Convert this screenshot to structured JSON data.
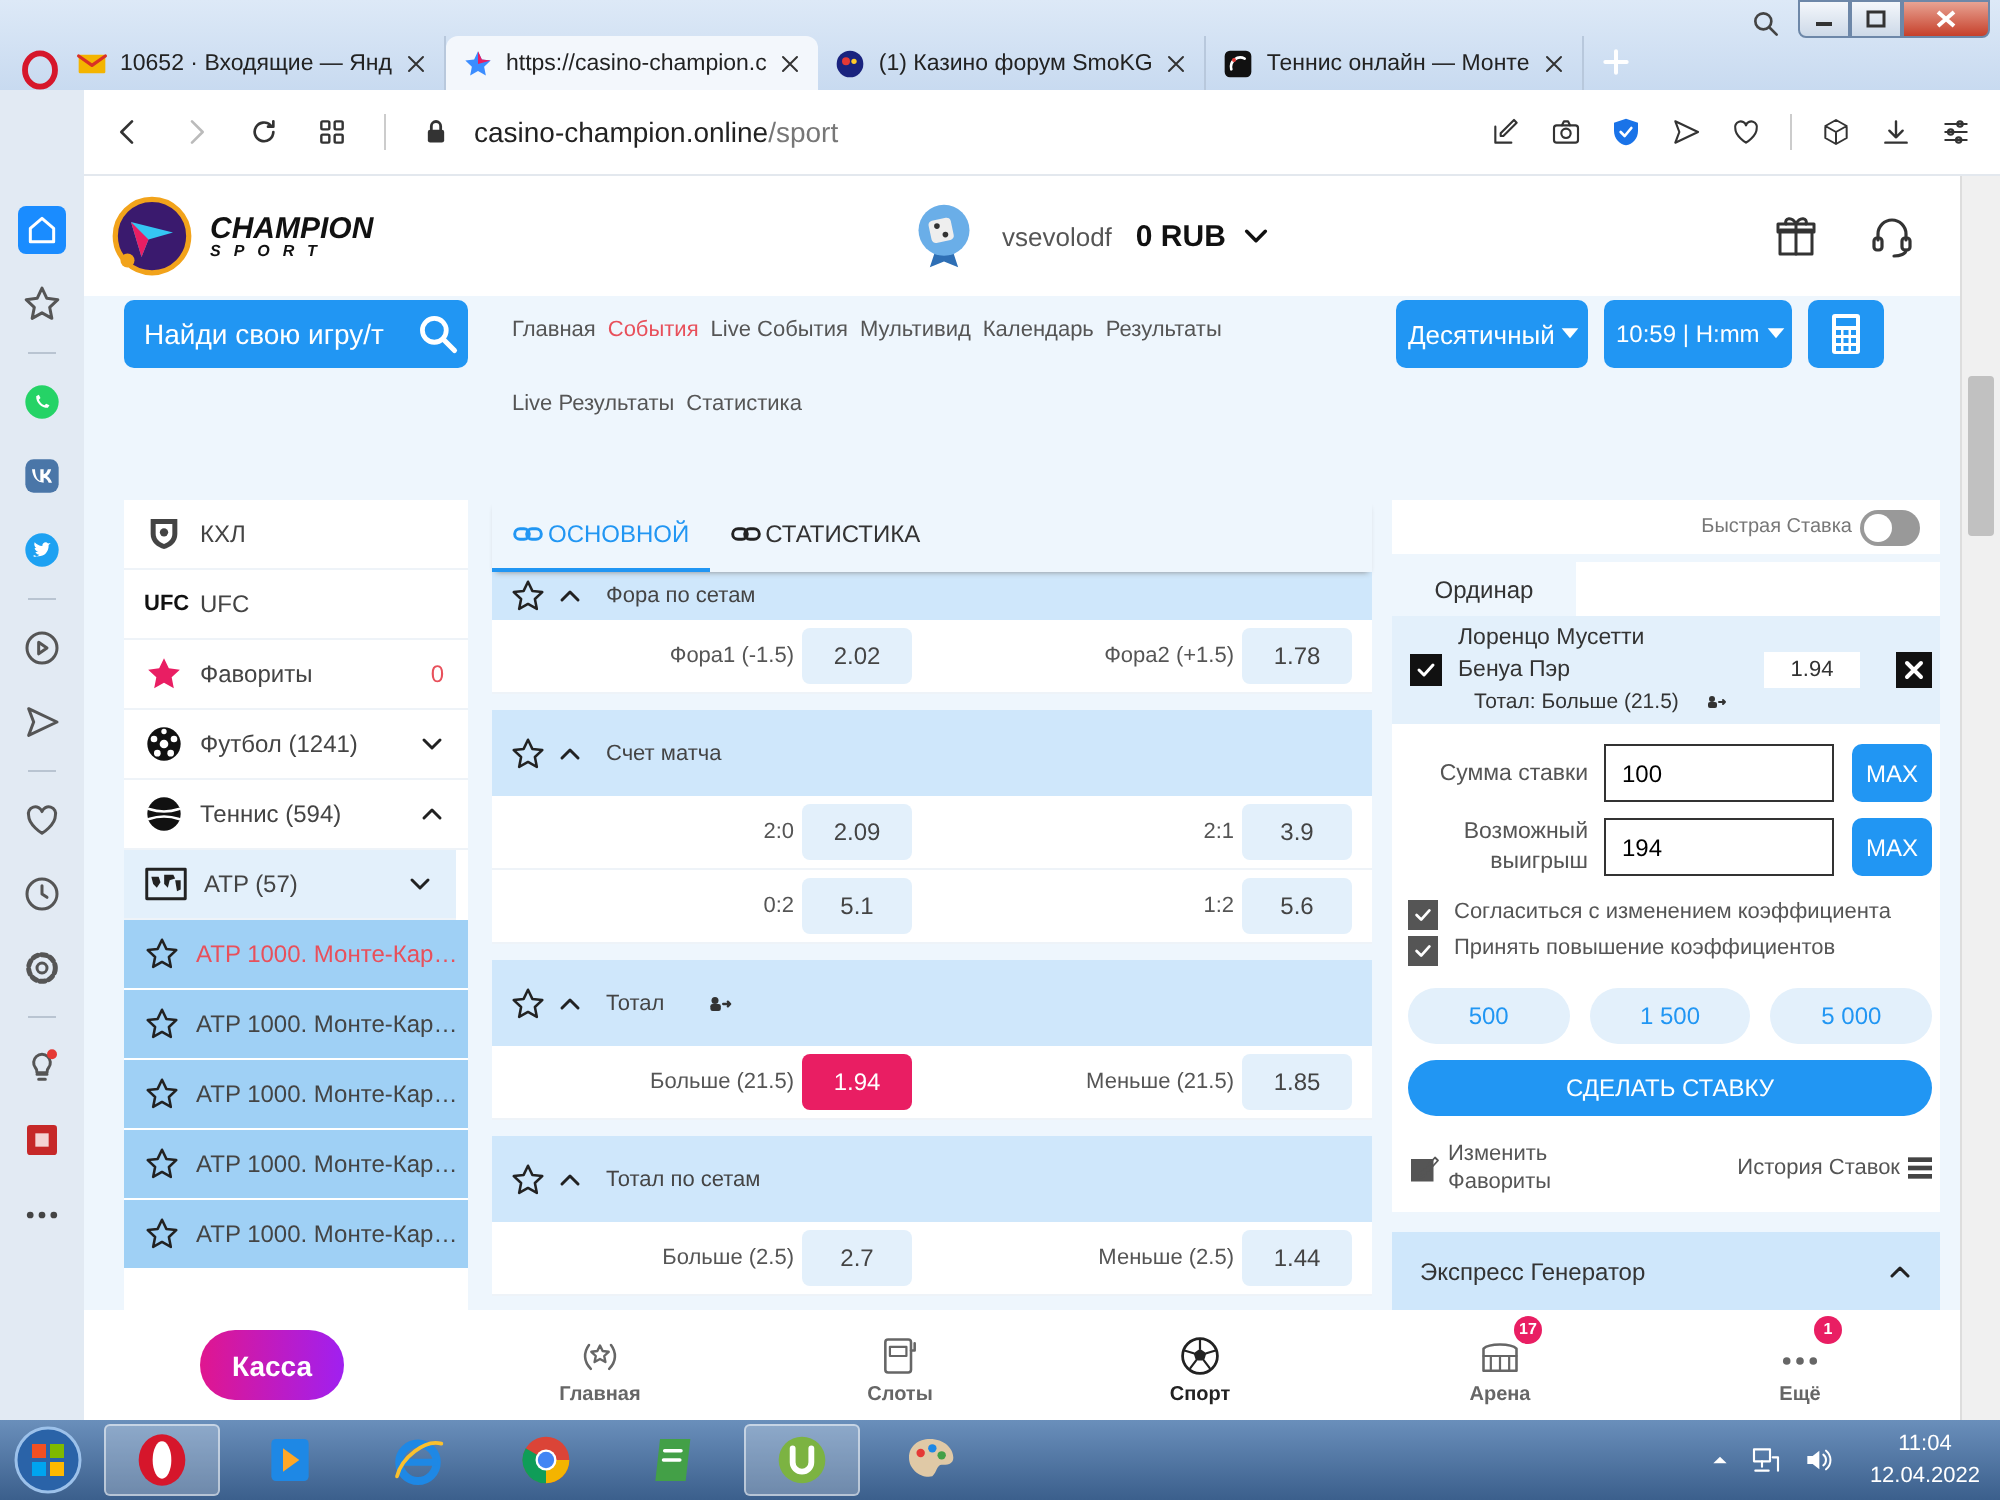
{
  "browser": {
    "tabs": [
      {
        "kind": "mail",
        "title": "10652 · Входящие — Янд",
        "selected": false
      },
      {
        "kind": "star",
        "title": "https://casino-champion.c",
        "selected": true
      },
      {
        "kind": "forum",
        "title": "(1) Казино форум SmoKG",
        "selected": false
      },
      {
        "kind": "tennis",
        "title": "Теннис онлайн — Монте",
        "selected": false
      }
    ],
    "address": {
      "host": "casino-champion.online",
      "path": "/sport"
    }
  },
  "opera_sidebar": {
    "groups": [
      [
        {
          "kind": "home",
          "selected": true
        },
        {
          "kind": "bookmarks",
          "selected": false
        }
      ],
      [
        {
          "kind": "whatsapp",
          "selected": false
        },
        {
          "kind": "vk",
          "selected": false
        },
        {
          "kind": "twitter",
          "selected": false
        }
      ],
      [
        {
          "kind": "player",
          "selected": false
        },
        {
          "kind": "send",
          "selected": false
        }
      ],
      [
        {
          "kind": "heart",
          "selected": false
        },
        {
          "kind": "history",
          "selected": false
        },
        {
          "kind": "settings",
          "selected": false
        }
      ],
      [
        {
          "kind": "bulb",
          "selected": false
        },
        {
          "kind": "extension",
          "selected": false
        },
        {
          "kind": "more",
          "selected": false
        }
      ]
    ]
  },
  "header": {
    "logo_title": "CHAMPION",
    "logo_subtitle": "SPORT",
    "username": "vsevolodf",
    "balance": "0 RUB"
  },
  "search": {
    "placeholder": "Найди свою игру/т"
  },
  "nav": [
    {
      "label": "Главная",
      "selected": false
    },
    {
      "label": "События",
      "selected": true
    },
    {
      "label": "Live События",
      "selected": false
    },
    {
      "label": "Мультивид",
      "selected": false
    },
    {
      "label": "Календарь",
      "selected": false
    },
    {
      "label": "Результаты",
      "selected": false
    },
    {
      "label": "Live Результаты",
      "selected": false
    },
    {
      "label": "Статистика",
      "selected": false
    }
  ],
  "format_dropdowns": [
    "Десятичный",
    "10:59 | H:mm"
  ],
  "sports_menu": [
    {
      "kind": "khl",
      "label": "КХЛ"
    },
    {
      "kind": "ufc",
      "badge": "UFC",
      "label": "UFC"
    },
    {
      "kind": "favorites",
      "label": "Фавориты",
      "count": "0"
    },
    {
      "kind": "football",
      "label": "Футбол (1241)",
      "expanded": false
    },
    {
      "kind": "tennis",
      "label": "Теннис (594)",
      "expanded": true,
      "children": [
        {
          "kind": "map",
          "label": "ATP (57)",
          "expanded": false,
          "children": [
            {
              "label": "ATP 1000. Монте-Кар…",
              "selected": true
            },
            {
              "label": "ATP 1000. Монте-Кар…",
              "selected": false
            },
            {
              "label": "ATP 1000. Монте-Кар…",
              "selected": false
            },
            {
              "label": "ATP 1000. Монте-Кар…",
              "selected": false
            },
            {
              "label": "ATP 1000. Монте-Кар…",
              "selected": false
            }
          ]
        }
      ]
    }
  ],
  "market_tabs": [
    {
      "label": "ОСНОВНОЙ",
      "selected": true
    },
    {
      "label": "СТАТИСТИКА",
      "selected": false
    }
  ],
  "markets": [
    {
      "title": "Фора по сетам",
      "has_cashout": false,
      "rows": [
        [
          {
            "label": "Фора1 (-1.5)",
            "odds": "2.02",
            "selected": false
          },
          {
            "label": "Фора2 (+1.5)",
            "odds": "1.78",
            "selected": false
          }
        ]
      ]
    },
    {
      "title": "Счет матча",
      "has_cashout": false,
      "rows": [
        [
          {
            "label": "2:0",
            "odds": "2.09",
            "selected": false
          },
          {
            "label": "2:1",
            "odds": "3.9",
            "selected": false
          }
        ],
        [
          {
            "label": "0:2",
            "odds": "5.1",
            "selected": false
          },
          {
            "label": "1:2",
            "odds": "5.6",
            "selected": false
          }
        ]
      ]
    },
    {
      "title": "Тотал",
      "has_cashout": true,
      "rows": [
        [
          {
            "label": "Больше (21.5)",
            "odds": "1.94",
            "selected": true
          },
          {
            "label": "Меньше (21.5)",
            "odds": "1.85",
            "selected": false
          }
        ]
      ]
    },
    {
      "title": "Тотал по сетам",
      "has_cashout": false,
      "rows": [
        [
          {
            "label": "Больше (2.5)",
            "odds": "2.7",
            "selected": false
          },
          {
            "label": "Меньше (2.5)",
            "odds": "1.44",
            "selected": false
          }
        ]
      ]
    }
  ],
  "betslip": {
    "quick_bet": {
      "label": "Быстрая Ставка",
      "on": false
    },
    "tab": "Ординар",
    "bet": {
      "checked": true,
      "player1": "Лоренцо Мусетти",
      "player2": "Бенуа Пэр",
      "odds": "1.94",
      "market": "Тотал: Больше (21.5)",
      "has_cashout": true
    },
    "stake": {
      "label": "Сумма ставки",
      "value": "100",
      "button": "MAX"
    },
    "win": {
      "label": "Возможный выигрыш",
      "value": "194",
      "button": "MAX"
    },
    "options": [
      {
        "label": "Согласиться с изменением коэффициента",
        "checked": true
      },
      {
        "label": "Принять повышение коэффициентов",
        "checked": true
      }
    ],
    "amounts": [
      "500",
      "1 500",
      "5 000"
    ],
    "submit": "СДЕЛАТЬ СТАВКУ",
    "edit_favorites": "Изменить Фавориты",
    "history": "История Ставок"
  },
  "express": {
    "title": "Экспресс Генератор",
    "expanded": true
  },
  "bottom_nav": {
    "cashier": "Касса",
    "items": [
      {
        "kind": "home",
        "label": "Главная",
        "selected": false
      },
      {
        "kind": "slots",
        "label": "Слоты",
        "selected": false
      },
      {
        "kind": "sport",
        "label": "Спорт",
        "selected": true
      },
      {
        "kind": "arena",
        "label": "Арена",
        "badge": "17",
        "selected": false
      },
      {
        "kind": "more",
        "label": "Ещё",
        "badge": "1",
        "selected": false
      }
    ]
  },
  "taskbar": {
    "apps": [
      {
        "kind": "opera",
        "active": true
      },
      {
        "kind": "media",
        "active": false
      },
      {
        "kind": "ie",
        "active": false
      },
      {
        "kind": "chrome",
        "active": false
      },
      {
        "kind": "notes",
        "active": false
      },
      {
        "kind": "torrent",
        "active": true
      },
      {
        "kind": "paint",
        "active": false
      }
    ],
    "time": "11:04",
    "date": "12.04.2022"
  }
}
